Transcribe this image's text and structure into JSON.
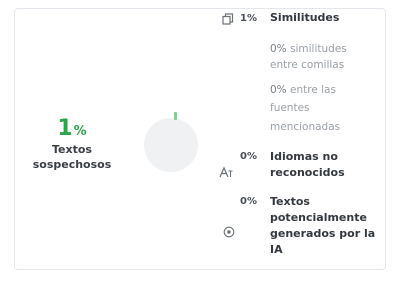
{
  "summary": {
    "percent": "1",
    "percent_symbol": "%",
    "label": "Textos sospechosos",
    "gauge_fraction": 0.01
  },
  "similitudes": {
    "value": "1%",
    "title": "Similitudes",
    "sub1_value": "0%",
    "sub1_text": "similitudes",
    "sub1_text2": "entre comillas",
    "sub2_value": "0%",
    "sub2_text": "entre las",
    "sub2_text2": "fuentes",
    "sub2_text3": "mencionadas"
  },
  "idiomas": {
    "value": "0%",
    "title": "Idiomas no reconocidos"
  },
  "ia": {
    "value": "0%",
    "title": "Textos potencialmente generados por la IA"
  },
  "colors": {
    "accent": "#2aa64a",
    "text": "#34393f",
    "muted": "#9ba1a7"
  }
}
